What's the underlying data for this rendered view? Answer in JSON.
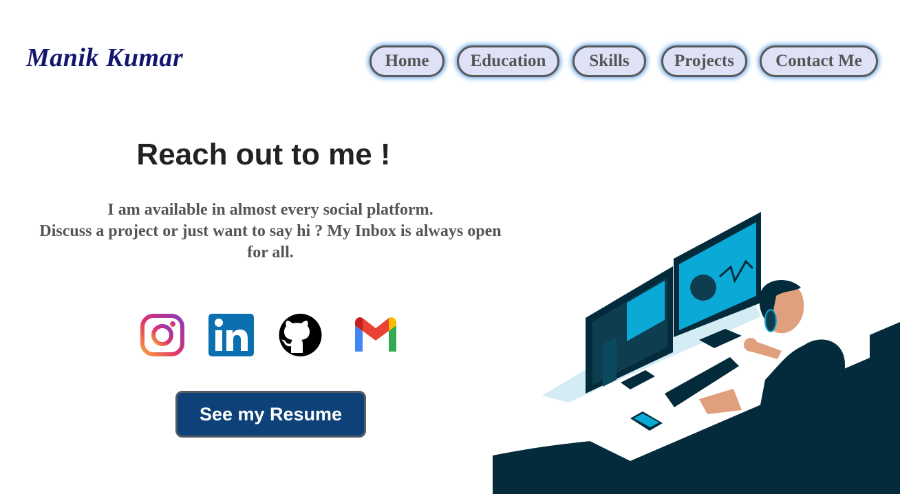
{
  "brand": {
    "name": "Manik Kumar"
  },
  "nav": {
    "home": "Home",
    "education": "Education",
    "skills": "Skills",
    "projects": "Projects",
    "contact": "Contact Me"
  },
  "contact": {
    "heading": "Reach out to me !",
    "line1": "I am available in almost every social platform.",
    "line2": "Discuss a project or just want to say hi ? My Inbox is always open for all.",
    "resume_label": "See my Resume"
  },
  "social_icons": [
    "instagram-icon",
    "linkedin-icon",
    "github-icon",
    "gmail-icon"
  ],
  "colors": {
    "brand": "#141770",
    "nav_bg": "#dfe2f7",
    "nav_glow": "#6aa8e8",
    "resume_bg": "#0d4177",
    "illustration_dark": "#032b3b",
    "screen_accent": "#0aa9d6"
  }
}
